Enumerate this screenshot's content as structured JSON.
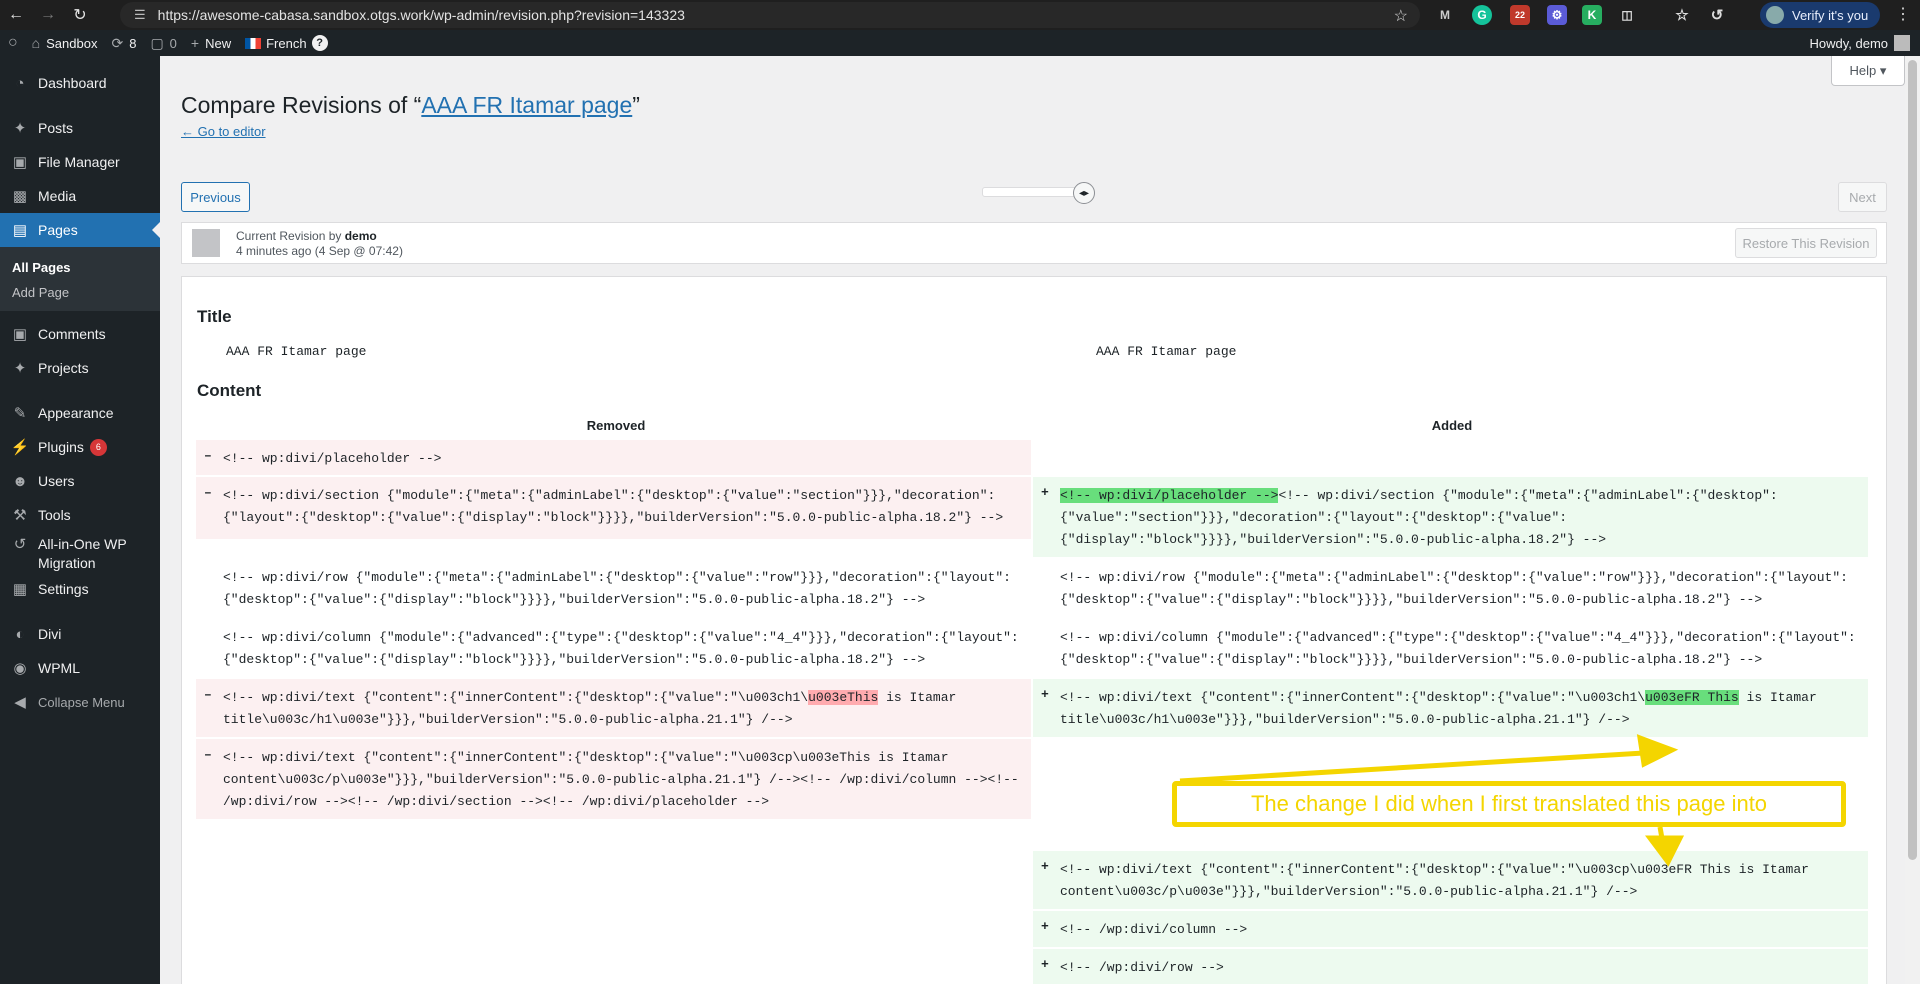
{
  "browser": {
    "url": "https://awesome-cabasa.sandbox.otgs.work/wp-admin/revision.php?revision=143323",
    "ext_badge": "22",
    "verify_label": "Verify it's you"
  },
  "adminbar": {
    "site": "Sandbox",
    "updates": "8",
    "comments": "0",
    "new": "New",
    "language": "French",
    "help": "?",
    "howdy": "Howdy, demo"
  },
  "sidebar": {
    "items": [
      {
        "label": "Dashboard",
        "icon": "dashboard-icon"
      },
      {
        "label": "Posts",
        "icon": "pin-icon"
      },
      {
        "label": "File Manager",
        "icon": "folder-icon"
      },
      {
        "label": "Media",
        "icon": "media-icon"
      },
      {
        "label": "Pages",
        "icon": "pages-icon"
      },
      {
        "label": "Comments",
        "icon": "comment-icon"
      },
      {
        "label": "Projects",
        "icon": "pin-icon"
      },
      {
        "label": "Appearance",
        "icon": "brush-icon"
      },
      {
        "label": "Plugins",
        "icon": "plug-icon",
        "badge": "6"
      },
      {
        "label": "Users",
        "icon": "user-icon"
      },
      {
        "label": "Tools",
        "icon": "wrench-icon"
      },
      {
        "label": "All-in-One WP Migration",
        "icon": "migration-icon"
      },
      {
        "label": "Settings",
        "icon": "settings-icon"
      },
      {
        "label": "Divi",
        "icon": "divi-icon"
      },
      {
        "label": "WPML",
        "icon": "wpml-icon"
      },
      {
        "label": "Collapse Menu",
        "icon": "collapse-icon"
      }
    ],
    "submenu": [
      "All Pages",
      "Add Page"
    ]
  },
  "main": {
    "help": "Help",
    "title_prefix": "Compare Revisions of “",
    "title_link": "AAA FR Itamar page",
    "title_suffix": "”",
    "go_to_editor": "← Go to editor",
    "previous": "Previous",
    "next": "Next",
    "revision_meta_label": "Current Revision by",
    "revision_author": "demo",
    "revision_time": "4 minutes ago (4 Sep @ 07:42)",
    "restore": "Restore This Revision"
  },
  "diff": {
    "title_section": "Title",
    "title_left": "AAA FR Itamar page",
    "title_right": "AAA FR Itamar page",
    "content_section": "Content",
    "removed_head": "Removed",
    "added_head": "Added",
    "left": {
      "r1": "<!-- wp:divi/placeholder -->",
      "r2a": "<!-- wp:divi/section {\"module\":{\"meta\":{\"adminLabel\":{\"desktop\":{\"value\":\"section\"}}},\"decoration\":",
      "r2b": "{\"layout\":{\"desktop\":{\"value\":{\"display\":\"block\"}}}},\"builderVersion\":\"5.0.0-public-alpha.18.2\"} -->",
      "c1a": "<!-- wp:divi/row {\"module\":{\"meta\":{\"adminLabel\":{\"desktop\":{\"value\":\"row\"}}},\"decoration\":{\"layout\":",
      "c1b": "{\"desktop\":{\"value\":{\"display\":\"block\"}}}},\"builderVersion\":\"5.0.0-public-alpha.18.2\"} -->",
      "c2a": "<!-- wp:divi/column {\"module\":{\"advanced\":{\"type\":{\"desktop\":{\"value\":\"4_4\"}}},\"decoration\":{\"layout\":",
      "c2b": "{\"desktop\":{\"value\":{\"display\":\"block\"}}}},\"builderVersion\":\"5.0.0-public-alpha.18.2\"} -->",
      "r3a_pre": "<!-- wp:divi/text {\"content\":{\"innerContent\":{\"desktop\":{\"value\":\"\\u003ch1\\",
      "r3a_hl": "u003eThis",
      "r3a_post": " is Itamar",
      "r3b": "title\\u003c/h1\\u003e\"}}},\"builderVersion\":\"5.0.0-public-alpha.21.1\"} /-->",
      "r4a": "<!-- wp:divi/text {\"content\":{\"innerContent\":{\"desktop\":{\"value\":\"\\u003cp\\u003eThis is Itamar",
      "r4b": "content\\u003c/p\\u003e\"}}},\"builderVersion\":\"5.0.0-public-alpha.21.1\"} /--><!-- /wp:divi/column --><!--",
      "r4c": "/wp:divi/row --><!-- /wp:divi/section --><!-- /wp:divi/placeholder -->"
    },
    "right": {
      "a1_hl": "<!-- wp:divi/placeholder -->",
      "a1a_post": "<!-- wp:divi/section {\"module\":{\"meta\":{\"adminLabel\":{\"desktop\":",
      "a1b": "{\"value\":\"section\"}}},\"decoration\":{\"layout\":{\"desktop\":{\"value\":",
      "a1c": "{\"display\":\"block\"}}}},\"builderVersion\":\"5.0.0-public-alpha.18.2\"} -->",
      "c1a": "<!-- wp:divi/row {\"module\":{\"meta\":{\"adminLabel\":{\"desktop\":{\"value\":\"row\"}}},\"decoration\":{\"layout\":",
      "c1b": "{\"desktop\":{\"value\":{\"display\":\"block\"}}}},\"builderVersion\":\"5.0.0-public-alpha.18.2\"} -->",
      "c2a": "<!-- wp:divi/column {\"module\":{\"advanced\":{\"type\":{\"desktop\":{\"value\":\"4_4\"}}},\"decoration\":{\"layout\":",
      "c2b": "{\"desktop\":{\"value\":{\"display\":\"block\"}}}},\"builderVersion\":\"5.0.0-public-alpha.18.2\"} -->",
      "a2a_pre": "<!-- wp:divi/text {\"content\":{\"innerContent\":{\"desktop\":{\"value\":\"\\u003ch1\\",
      "a2a_hl": "u003eFR This",
      "a2a_post": " is Itamar",
      "a2b": "title\\u003c/h1\\u003e\"}}},\"builderVersion\":\"5.0.0-public-alpha.21.1\"} /-->",
      "a3a": "<!-- wp:divi/text {\"content\":{\"innerContent\":{\"desktop\":{\"value\":\"\\u003cp\\u003eFR This is Itamar",
      "a3b": "content\\u003c/p\\u003e\"}}},\"builderVersion\":\"5.0.0-public-alpha.21.1\"} /-->",
      "a4": "<!-- /wp:divi/column -->",
      "a5": "<!-- /wp:divi/row -->"
    },
    "minus": "–",
    "plus": "+"
  },
  "annotation": {
    "text": "The change I did when I first translated this page into",
    "color": "#f4d500"
  },
  "colors": {
    "wp_blue": "#2271b1",
    "admin_dark": "#1d2327",
    "removed_bg": "#fcf0f1",
    "added_bg": "#edfaef",
    "removed_hl": "#ffabaf",
    "added_hl": "#68de7c"
  }
}
